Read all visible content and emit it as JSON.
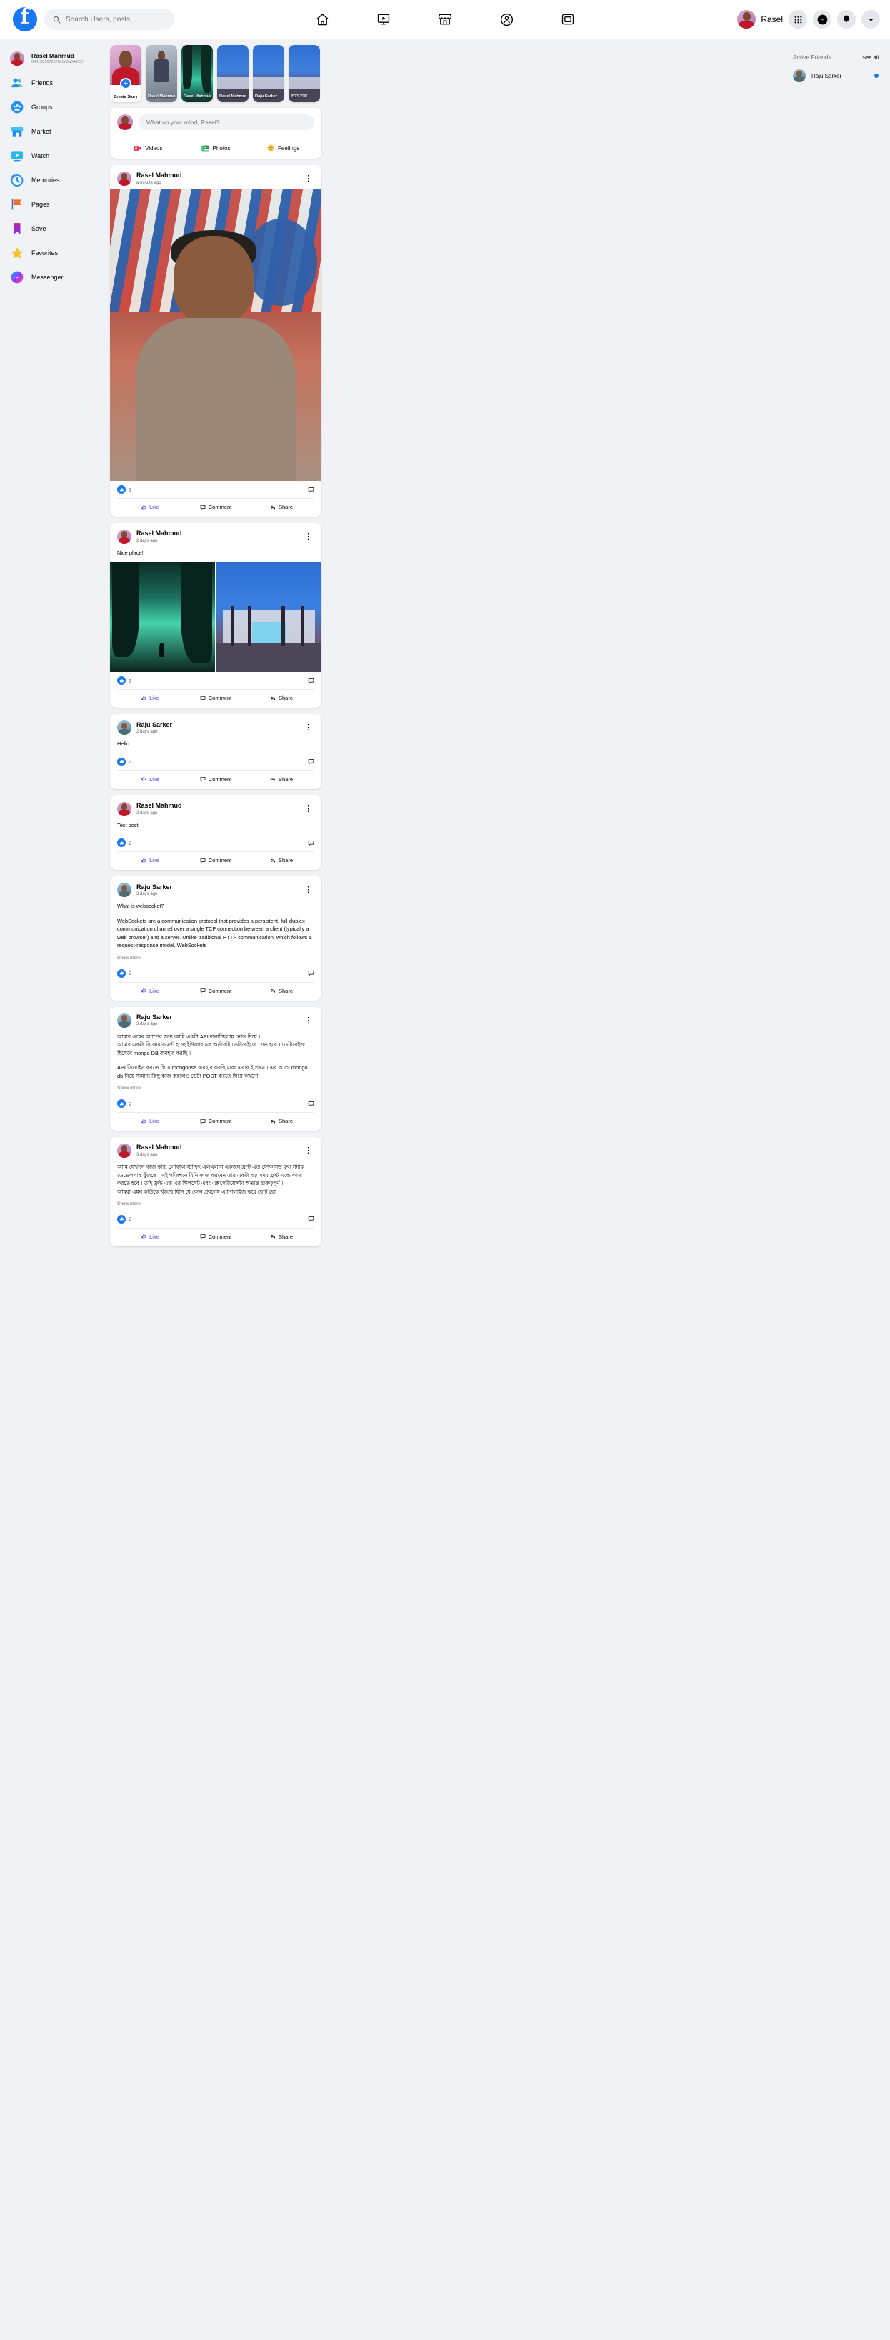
{
  "header": {
    "logo_icon": "facebook-logo",
    "search": {
      "placeholder": "Search Users, posts",
      "value": "",
      "icon": "search-icon"
    },
    "nav": [
      {
        "name": "home",
        "icon": "home-icon"
      },
      {
        "name": "watch",
        "icon": "video-play-icon"
      },
      {
        "name": "marketplace",
        "icon": "store-icon"
      },
      {
        "name": "groups",
        "icon": "groups-icon"
      },
      {
        "name": "gaming",
        "icon": "gaming-icon"
      }
    ],
    "user_name": "Rasel",
    "actions": [
      {
        "name": "menu-grid",
        "icon": "grid-icon"
      },
      {
        "name": "messenger",
        "icon": "messenger-icon"
      },
      {
        "name": "notifications",
        "icon": "bell-icon"
      },
      {
        "name": "account",
        "icon": "chevron-down-icon"
      }
    ]
  },
  "sidebar": {
    "profile": {
      "name": "Rasel Mahmud",
      "id": "6481855672670e3e3a64665f"
    },
    "items": [
      {
        "label": "Friends",
        "icon": "friends-icon"
      },
      {
        "label": "Groups",
        "icon": "groups-icon"
      },
      {
        "label": "Market",
        "icon": "market-icon"
      },
      {
        "label": "Watch",
        "icon": "watch-icon"
      },
      {
        "label": "Memories",
        "icon": "memories-icon"
      },
      {
        "label": "Pages",
        "icon": "pages-flag-icon"
      },
      {
        "label": "Save",
        "icon": "bookmark-icon"
      },
      {
        "label": "Favorites",
        "icon": "star-icon"
      },
      {
        "label": "Messenger",
        "icon": "messenger-icon"
      }
    ]
  },
  "stories": {
    "create_label": "Create Story",
    "items": [
      {
        "name": "Rasel Mahmud",
        "style": "person"
      },
      {
        "name": "Rasel Mahmud",
        "style": "forest"
      },
      {
        "name": "Rasel Mahmud",
        "style": "palm"
      },
      {
        "name": "Raju Sarker",
        "style": "palm"
      },
      {
        "name": "করিম মিয়া",
        "style": "palm"
      }
    ]
  },
  "composer": {
    "placeholder": "What on your mind, Rasel?",
    "value": "",
    "actions": [
      {
        "label": "Videos",
        "icon": "video-camera-icon"
      },
      {
        "label": "Photos",
        "icon": "photo-icon"
      },
      {
        "label": "Feelings",
        "icon": "smiley-icon"
      }
    ]
  },
  "post_actions": {
    "like": "Like",
    "comment": "Comment",
    "share": "Share"
  },
  "show_more_label": "Show more",
  "posts": [
    {
      "author": "Rasel Mahmud",
      "avatar": "rasel",
      "time": "a minute ago",
      "text": "",
      "media": "portrait",
      "reactions": "1",
      "liked": true
    },
    {
      "author": "Rasel Mahmud",
      "avatar": "rasel",
      "time": "2 days ago",
      "text": "Nice place!!",
      "media": "duo",
      "reactions": "2",
      "liked": true
    },
    {
      "author": "Raju Sarker",
      "avatar": "raju",
      "time": "2 days ago",
      "text": "Hello",
      "media": "",
      "reactions": "2",
      "liked": true
    },
    {
      "author": "Rasel Mahmud",
      "avatar": "rasel",
      "time": "2 days ago",
      "text": "Test post",
      "media": "",
      "reactions": "2",
      "liked": true
    },
    {
      "author": "Raju Sarker",
      "avatar": "raju",
      "time": "3 days ago",
      "text": "What is websocket?",
      "text2": "WebSockets are a communication protocol that provides a persistent, full-duplex communication channel over a single TCP connection between a client (typically a web browser) and a server. Unlike traditional HTTP communication, which follows a request-response model, WebSockets",
      "show_more": true,
      "media": "",
      "reactions": "2",
      "liked": true
    },
    {
      "author": "Raju Sarker",
      "avatar": "raju",
      "time": "3 days ago",
      "text": "আমার ওয়েব অ্যাপের জন্য আমি একটা API বানাচ্ছিলাম নোড দিয়ে ।\nআমার একটা রিকোয়ারমেন্ট হচ্ছে ইউজার এর অর্ডারটা ডেটাবেইজে সেভ হবে । ডেটাবেইজ হিসেবে mongo DB ব্যবহার করছি ।",
      "text2": "API ডিজাইন করতে গিয়ে mongoose ব্যবহার করছি এবং এবার ই প্রথম । এর আগে mongo db নিয়ে সামান্য কিছু কাজ করলেও ডেটা POST করতে গিয়ে কখনো",
      "show_more": true,
      "media": "",
      "reactions": "2",
      "liked": true
    },
    {
      "author": "Rasel Mahmud",
      "avatar": "rasel",
      "time": "3 days ago",
      "text": "আমি যেখানে কাজ করি, লোকাল স্টাফিং এলএলসি একজন ফ্রন্ট এন্ড ফোকাসড ফুল স্ট্যাক ডেভেলপার খুঁজছে । এই পজিশনে যিনি কাজ করবেন তার একটা বড় সময় ফ্রন্ট এন্ডে কাজ করতে হবে । তাই ফ্রন্ট এন্ড এর স্কিলসেট এবং এক্সপেরিয়েন্সটা অত্যন্ত গুরুত্বপূর্ণ ।\nআমরা এমন কাউকে খুঁজছি যিনি যে কোন প্রবলেম এ্যানালাইজ করে ছোট ছো",
      "show_more": true,
      "media": "",
      "reactions": "2",
      "liked": true
    }
  ],
  "rightbar": {
    "title": "Active Friends",
    "see_all": "See all",
    "friends": [
      {
        "name": "Raju Sarker",
        "avatar": "raju",
        "online": true
      }
    ]
  },
  "colors": {
    "brand": "#1877f2",
    "liked": "#4f46e5",
    "page_bg": "#f0f2f5",
    "online": "#1b74e4"
  }
}
